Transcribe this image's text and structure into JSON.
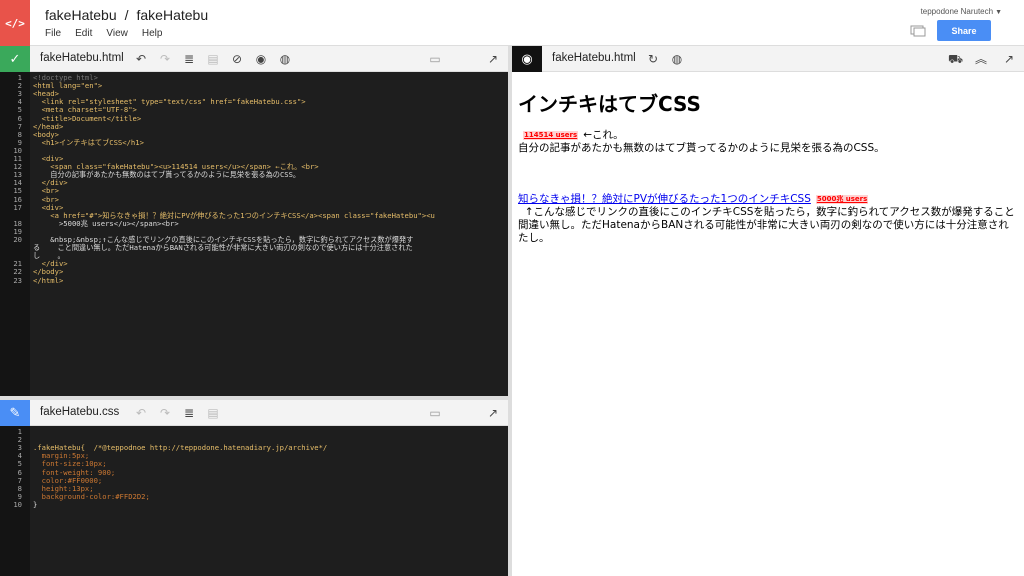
{
  "app": {
    "logo": "</>",
    "user_name": "teppodone Narutech",
    "share_label": "Share",
    "breadcrumb": [
      "fakeHatebu",
      "/",
      "fakeHatebu"
    ],
    "menu": [
      "File",
      "Edit",
      "View",
      "Help"
    ]
  },
  "html_pane": {
    "filename": "fakeHatebu.html",
    "icon": "check-icon",
    "accent": "#3aa95b",
    "lines": [
      "<!doctype html>",
      "<html lang=\"en\">",
      "<head>",
      "  <link rel=\"stylesheet\" type=\"text/css\" href=\"fakeHatebu.css\">",
      "  <meta charset=\"UTF-8\">",
      "  <title>Document</title>",
      "</head>",
      "<body>",
      "  <h1>インチキはてブCSS</h1>",
      "",
      "  <div>",
      "    <span class=\"fakeHatebu\"><u>114514 users</u></span> ←これ。<br>",
      "    自分の記事があたかも無数のはてブ貰ってるかのように見栄を張る為のCSS。",
      "  </div>",
      "  <br>",
      "  <br>",
      "  <div>",
      "    <a href=\"#\">知らなきゃ損！？絶対にPVが伸びるたった1つのインチキCSS</a><span class=\"fakeHatebu\"><u",
      "      >5000兆 users</u></span><br>",
      "",
      "    &nbsp;&nbsp;↑こんな感じでリンクの直後にこのインチキCSSを貼ったら，数字に釣られてアクセス数が爆発す",
      "る    こと間違い無し。ただHatenaからBANされる可能性が非常に大きい両刃の剣なので使い方には十分注意された",
      "し    。",
      "  </div>",
      "</body>",
      "</html>"
    ],
    "line_numbers": [
      "1",
      "2",
      "3",
      "4",
      "5",
      "6",
      "7",
      "8",
      "9",
      "10",
      "11",
      "12",
      "13",
      "14",
      "15",
      "16",
      "17",
      "",
      "18",
      "19",
      "20",
      "",
      "",
      "21",
      "22",
      "23"
    ]
  },
  "css_pane": {
    "filename": "fakeHatebu.css",
    "icon": "brush-icon",
    "accent": "#4a8ef5",
    "lines": [
      "",
      "",
      ".fakeHatebu{  /*@teppodnoe http://teppodone.hatenadiary.jp/archive*/",
      "  margin:5px;",
      "  font-size:10px;",
      "  font-weight: 900;",
      "  color:#FF0000;",
      "  height:13px;",
      "  background-color:#FFD2D2;",
      "}"
    ],
    "line_numbers": [
      "1",
      "2",
      "3",
      "4",
      "5",
      "6",
      "7",
      "8",
      "9",
      "10"
    ]
  },
  "preview_pane": {
    "filename": "fakeHatebu.html",
    "icon": "eye-icon",
    "h1": "インチキはてブCSS",
    "badge1": "114514 users",
    "arrow_text": "←これ。",
    "line2": "自分の記事があたかも無数のはてブ貰ってるかのように見栄を張る為のCSS。",
    "link": "知らなきゃ損！？絶対にPVが伸びるたった1つのインチキCSS",
    "badge2": "5000兆 users",
    "para": "↑こんな感じでリンクの直後にこのインチキCSSを貼ったら，数字に釣られてアクセス数が爆発すること間違い無し。ただHatenaからBANされる可能性が非常に大きい両刃の剣なので使い方には十分注意されたし。"
  }
}
